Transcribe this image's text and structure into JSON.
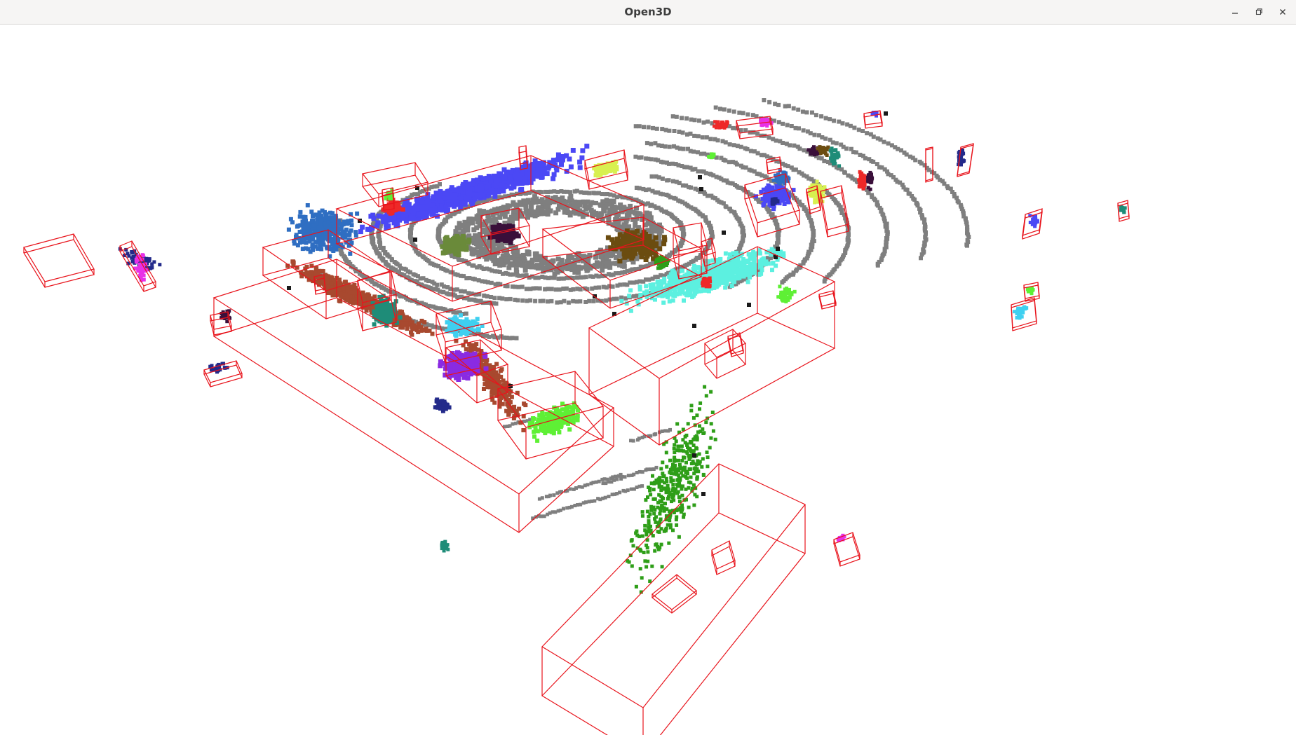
{
  "window": {
    "title": "Open3D",
    "controls": {
      "minimize": "minimize-icon",
      "maximize": "restore-icon",
      "close": "close-icon"
    }
  },
  "viewer": {
    "background": "#ffffff",
    "bbox_color": "#e8141c",
    "ground_points_color": "#7f7f7f",
    "cluster_colors": [
      "#4b48f5",
      "#2f6ec2",
      "#a8492f",
      "#5cf0e0",
      "#2e9e18",
      "#6b4c10",
      "#8a2be2",
      "#e830e8",
      "#1e8c78",
      "#3fd0f0",
      "#6a8a3a",
      "#5ef035",
      "#3a0f3a",
      "#d8f050",
      "#ee2828",
      "#232a8a"
    ]
  }
}
